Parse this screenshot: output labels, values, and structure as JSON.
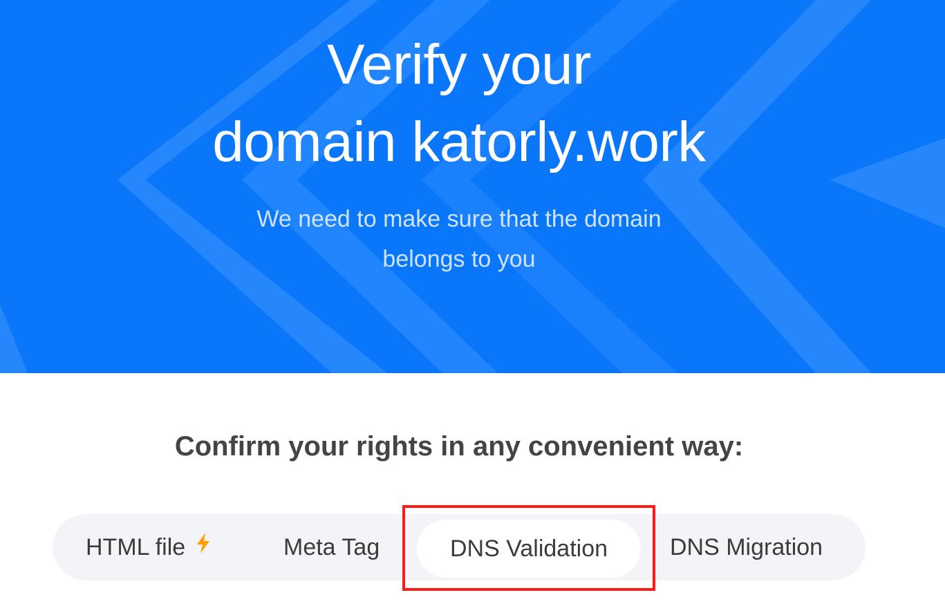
{
  "hero": {
    "title_line1": "Verify your",
    "title_line2": "domain katorly.work",
    "subtitle_line1": "We need to make sure that the domain",
    "subtitle_line2": "belongs to you",
    "background_color": "#0a77fb"
  },
  "confirm": {
    "heading": "Confirm your rights in any convenient way:"
  },
  "tabs": [
    {
      "label": "HTML file",
      "icon": "lightning-bolt-icon",
      "selected": false
    },
    {
      "label": "Meta Tag",
      "selected": false
    },
    {
      "label": "DNS Validation",
      "selected": true
    },
    {
      "label": "DNS Migration",
      "selected": false
    }
  ],
  "colors": {
    "accent": "#0a77fb",
    "bolt": "#ffa000",
    "highlight": "#ff1a1a"
  }
}
